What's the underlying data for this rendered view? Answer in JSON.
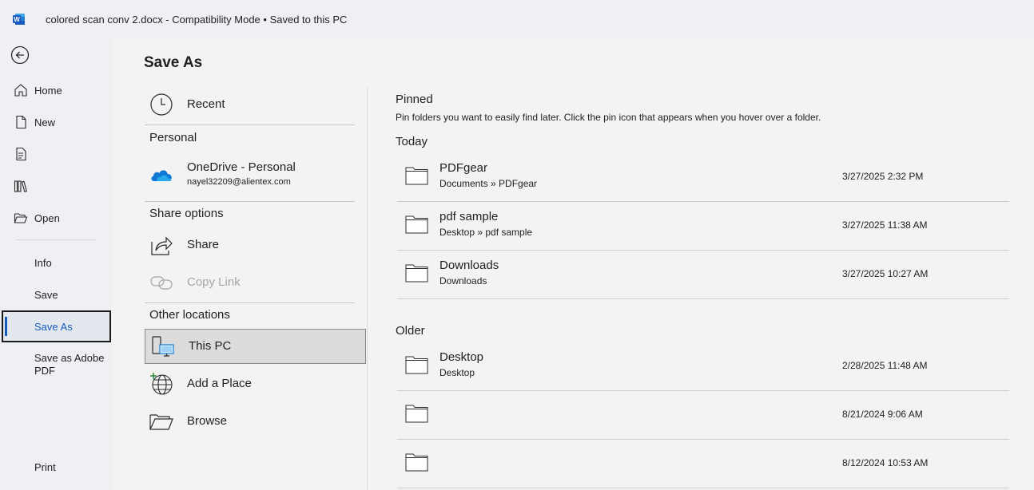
{
  "titlebar": {
    "title": "colored scan conv 2.docx  -  Compatibility Mode  •  Saved to this PC",
    "logo_color": "#185abd"
  },
  "nav": {
    "back_icon": "back-arrow-icon",
    "items": [
      {
        "label": "Home",
        "icon": "home-icon"
      },
      {
        "label": "New",
        "icon": "new-document-icon"
      },
      {
        "label": "",
        "icon": "templates-icon"
      },
      {
        "label": "",
        "icon": "library-icon"
      },
      {
        "label": "Open",
        "icon": "folder-open-icon"
      },
      {
        "label": "Info"
      },
      {
        "label": "Save"
      },
      {
        "label": "Save As"
      },
      {
        "label": "Save as Adobe PDF"
      },
      {
        "label": "Print"
      }
    ],
    "active": "Save As",
    "accent": "#185abd"
  },
  "page": {
    "title": "Save As"
  },
  "locations": {
    "recent": "Recent",
    "personal_heading": "Personal",
    "onedrive_label": "OneDrive - Personal",
    "onedrive_email": "nayel32209@alientex.com",
    "share_heading": "Share options",
    "share": "Share",
    "copy_link": "Copy Link",
    "other_heading": "Other locations",
    "this_pc": "This PC",
    "add_place": "Add a Place",
    "browse": "Browse"
  },
  "files": {
    "pinned_heading": "Pinned",
    "pinned_desc": "Pin folders you want to easily find later. Click the pin icon that appears when you hover over a folder.",
    "today_heading": "Today",
    "older_heading": "Older",
    "today": [
      {
        "name": "PDFgear",
        "path": "Documents » PDFgear",
        "date": "3/27/2025 2:32 PM"
      },
      {
        "name": "pdf sample",
        "path": "Desktop » pdf sample",
        "date": "3/27/2025 11:38 AM"
      },
      {
        "name": "Downloads",
        "path": "Downloads",
        "date": "3/27/2025 10:27 AM"
      }
    ],
    "older": [
      {
        "name": "Desktop",
        "path": "Desktop",
        "date": "2/28/2025 11:48 AM"
      },
      {
        "name": "",
        "path": "",
        "date": "8/21/2024 9:06 AM"
      },
      {
        "name": "",
        "path": "",
        "date": "8/12/2024 10:53 AM"
      }
    ]
  }
}
